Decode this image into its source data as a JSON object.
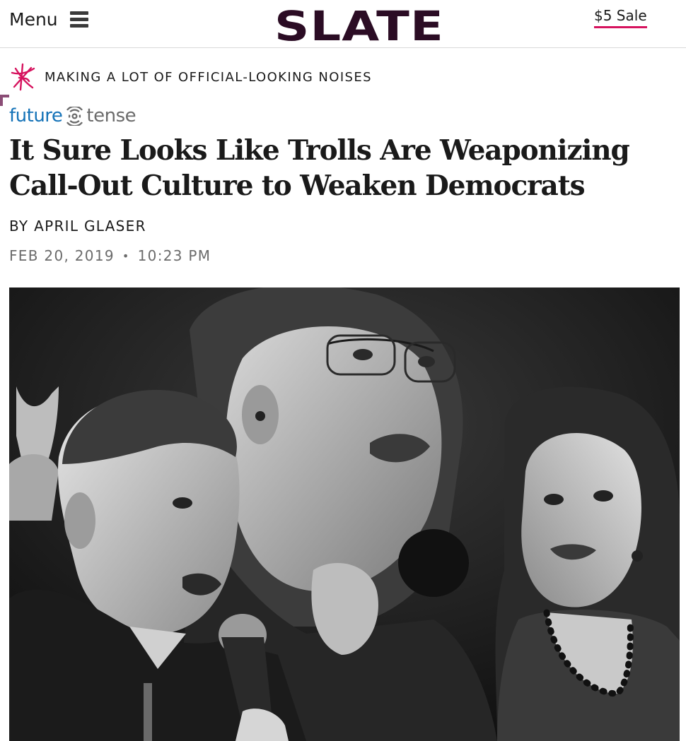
{
  "header": {
    "menu_label": "Menu",
    "logo_text": "SLATE",
    "sale_label": "$5 Sale"
  },
  "kicker": {
    "text": "MAKING A LOT OF OFFICIAL-LOOKING NOISES",
    "icon": "scribble-star-icon",
    "color": "#d6135e"
  },
  "section": {
    "brand_part1": "future",
    "brand_part2": "tense",
    "icon": "signal-rings-icon",
    "color_part1": "#1573b8",
    "color_part2": "#6b6b6b"
  },
  "article": {
    "headline": "It Sure Looks Like Trolls Are Weaponizing Call-Out Culture to Weaken Democrats",
    "byline_prefix": "BY",
    "author": "APRIL GLASER",
    "date": "FEB 20, 2019",
    "separator": "•",
    "time": "10:23 PM"
  },
  "hero_image": {
    "style": "black-and-white photo collage of three people, one speaking into a microphone"
  }
}
